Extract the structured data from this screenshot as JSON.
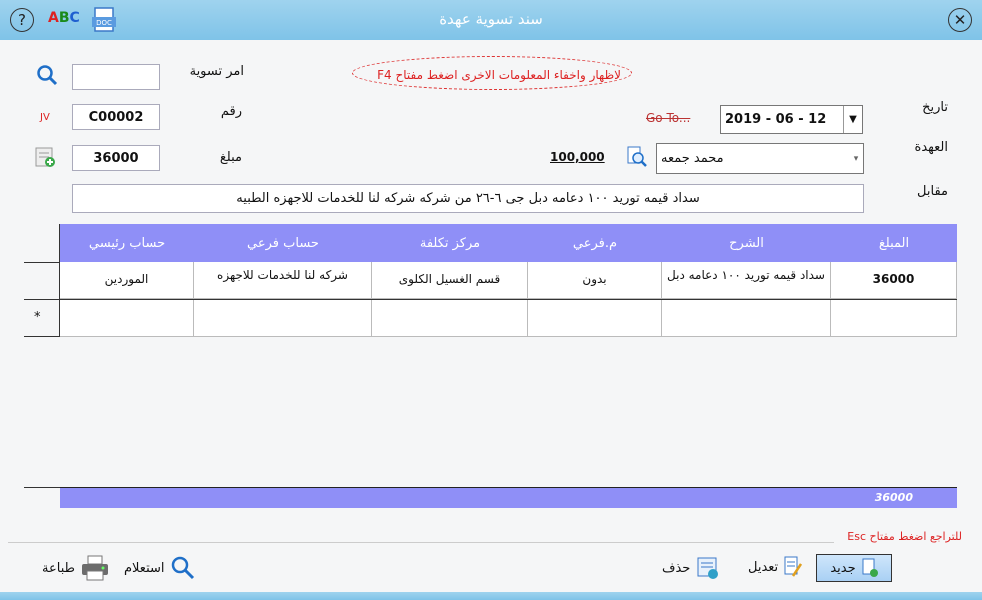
{
  "window": {
    "title": "سند تسوية عهدة"
  },
  "toolbar": {
    "help_symbol": "?",
    "close_symbol": "✕",
    "spell_abc": [
      "A",
      "B",
      "C"
    ],
    "doc_label": "DOC"
  },
  "form": {
    "settlement_order_label": "امر تسوية",
    "settlement_order_value": "",
    "number_label": "رقم",
    "number_value": "C00002",
    "jv_tag": "JV",
    "amount_label": "مبلغ",
    "amount_value": "36000",
    "date_label": "تاريخ",
    "date_value": "2019 - 06 - 12",
    "goto_label": "Go To...",
    "custody_label": "العهدة",
    "custody_value": "محمد جمعه",
    "custody_balance": "100,000",
    "against_label": "مقابل",
    "against_value": "سداد قيمه توريد ١٠٠ دعامه دبل جى ٦-٢٦ من شركه شركه لنا للخدمات للاجهزه الطبيه",
    "hint_text": "لاظهار واخفاء المعلومات الاخرى اضغط مفتاح F4"
  },
  "grid": {
    "columns": [
      "المبلغ",
      "الشرح",
      "م.فرعي",
      "مركز تكلفة",
      "حساب فرعي",
      "حساب رئيسي"
    ],
    "rows": [
      {
        "amount": "36000",
        "description": "سداد قيمه توريد ١٠٠ دعامه دبل",
        "sub_cost": "بدون",
        "cost_center": "قسم الغسيل الكلوى",
        "sub_account": "شركه لنا للخدمات للاجهزه",
        "main_account": "الموردين"
      }
    ],
    "new_row_marker": "*",
    "total": "36000"
  },
  "esc_hint": "للتراجع اضغط مفتاح Esc",
  "buttons": {
    "new": "جديد",
    "edit": "تعديل",
    "delete": "حذف",
    "query": "استعلام",
    "print": "طباعة"
  },
  "colors": {
    "titlebar": "#8ccbeb",
    "grid_header": "#8f8ff7",
    "hint_red": "#d22222"
  }
}
